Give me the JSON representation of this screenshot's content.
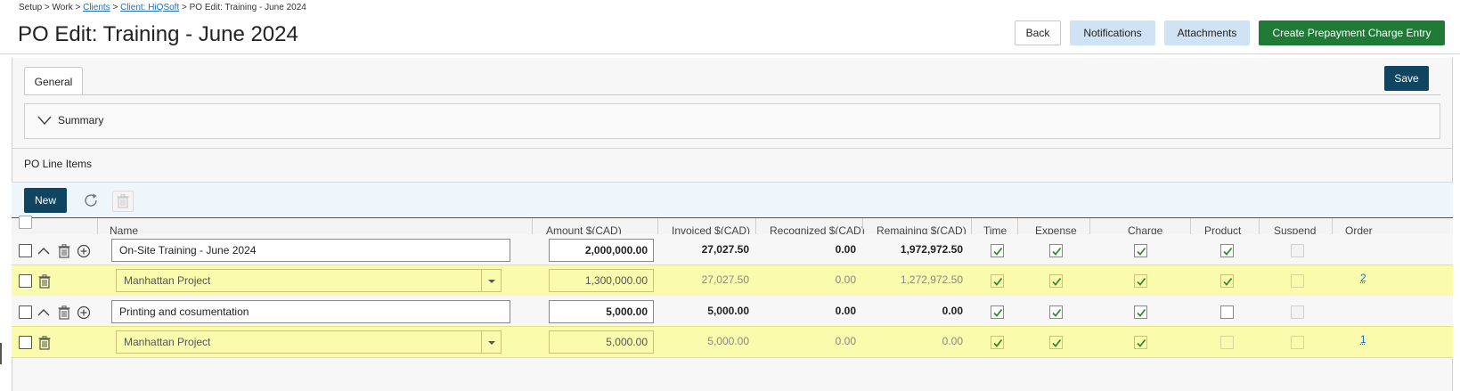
{
  "breadcrumb": {
    "items": [
      "Setup",
      "Work",
      "Clients",
      "Client: HiQSoft",
      "PO Edit: Training - June 2024"
    ],
    "separator": ">"
  },
  "page_title": "PO Edit: Training - June 2024",
  "header_buttons": {
    "back": "Back",
    "notifications": "Notifications",
    "attachments": "Attachments",
    "create_prepayment": "Create Prepayment Charge Entry"
  },
  "tabs": {
    "general": "General"
  },
  "save_label": "Save",
  "summary_label": "Summary",
  "po_line_items_label": "PO Line Items",
  "new_label": "New",
  "columns": {
    "name": "Name",
    "amount": "Amount $(CAD)",
    "invoiced": "Invoiced $(CAD)",
    "recognized": "Recognized $(CAD)",
    "remaining": "Remaining $(CAD)",
    "time": "Time",
    "expense": "Expense",
    "charge": "Charge",
    "product": "Product",
    "suspend": "Suspend",
    "order": "Order"
  },
  "rows": [
    {
      "type": "line",
      "name": "On-Site Training - June 2024",
      "amount": "2,000,000.00",
      "invoiced": "27,027.50",
      "recognized": "0.00",
      "remaining": "1,972,972.50",
      "time": true,
      "expense": true,
      "charge": true,
      "product": true,
      "suspend": false,
      "order": ""
    },
    {
      "type": "allocation",
      "name": "Manhattan Project",
      "amount": "1,300,000.00",
      "invoiced": "27,027.50",
      "recognized": "0.00",
      "remaining": "1,272,972.50",
      "time": true,
      "expense": true,
      "charge": true,
      "product": true,
      "suspend": false,
      "order": "2"
    },
    {
      "type": "line",
      "name": "Printing and cosumentation",
      "amount": "5,000.00",
      "invoiced": "5,000.00",
      "recognized": "0.00",
      "remaining": "0.00",
      "time": true,
      "expense": true,
      "charge": true,
      "product": false,
      "suspend": false,
      "order": ""
    },
    {
      "type": "allocation",
      "name": "Manhattan Project",
      "amount": "5,000.00",
      "invoiced": "5,000.00",
      "recognized": "0.00",
      "remaining": "0.00",
      "time": true,
      "expense": true,
      "charge": true,
      "product": false,
      "suspend": false,
      "order": "1"
    }
  ],
  "colors": {
    "primary_dark": "#0f4561",
    "create_green": "#1e7a35",
    "light_blue_button": "#cfe3f5",
    "allocation_row": "#fbfbae",
    "check_green": "#2e8b2e",
    "link_blue": "#1f6fb5"
  },
  "icons": {
    "collapse": "chevron-down-icon",
    "row_collapse": "chevron-up-icon",
    "delete": "trash-icon",
    "add": "plus-circle-icon",
    "refresh": "refresh-icon",
    "dropdown": "caret-down-icon"
  }
}
